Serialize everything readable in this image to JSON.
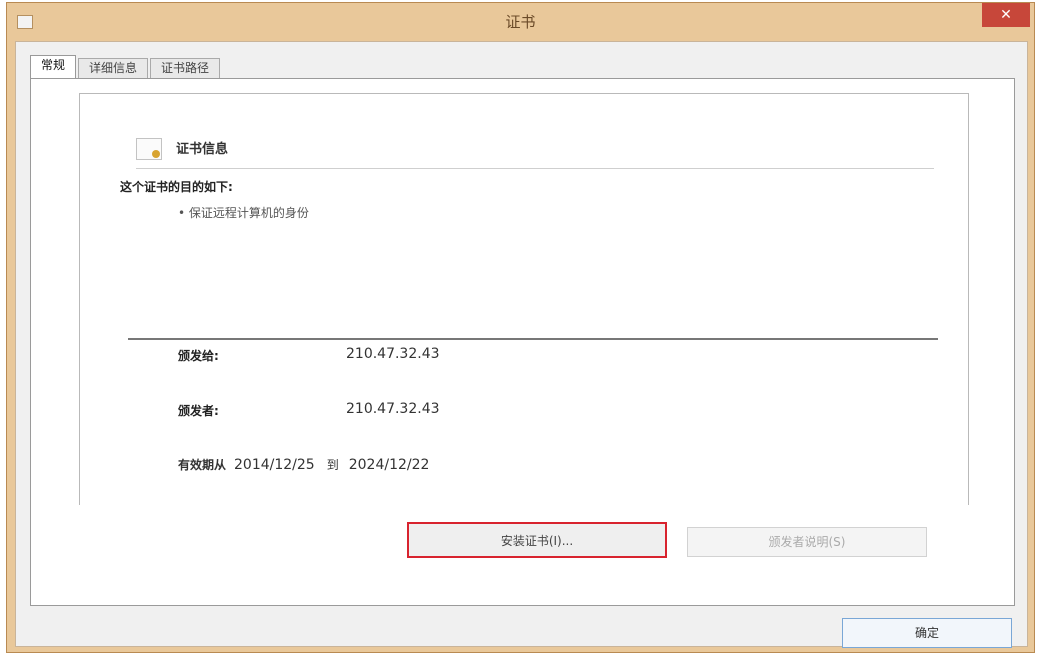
{
  "window": {
    "title": "证书",
    "close_glyph": "✕"
  },
  "tabs": [
    {
      "label": "常规",
      "active": true
    },
    {
      "label": "详细信息",
      "active": false
    },
    {
      "label": "证书路径",
      "active": false
    }
  ],
  "cert_info": {
    "icon": "certificate-icon",
    "heading": "证书信息",
    "purpose_label": "这个证书的目的如下:",
    "purposes": [
      "• 保证远程计算机的身份"
    ]
  },
  "details": {
    "issued_to_label": "颁发给:",
    "issued_to_value": "210.47.32.43",
    "issued_by_label": "颁发者:",
    "issued_by_value": "210.47.32.43",
    "valid_from_label": "有效期从",
    "valid_from": "2014/12/25",
    "valid_to_label": "到",
    "valid_to": "2024/12/22"
  },
  "buttons": {
    "install": "安装证书(I)...",
    "issuer_statement": "颁发者说明(S)",
    "ok": "确定"
  },
  "colors": {
    "titlebar": "#e9c89a",
    "close": "#c7473a",
    "highlight": "#d8232e"
  }
}
